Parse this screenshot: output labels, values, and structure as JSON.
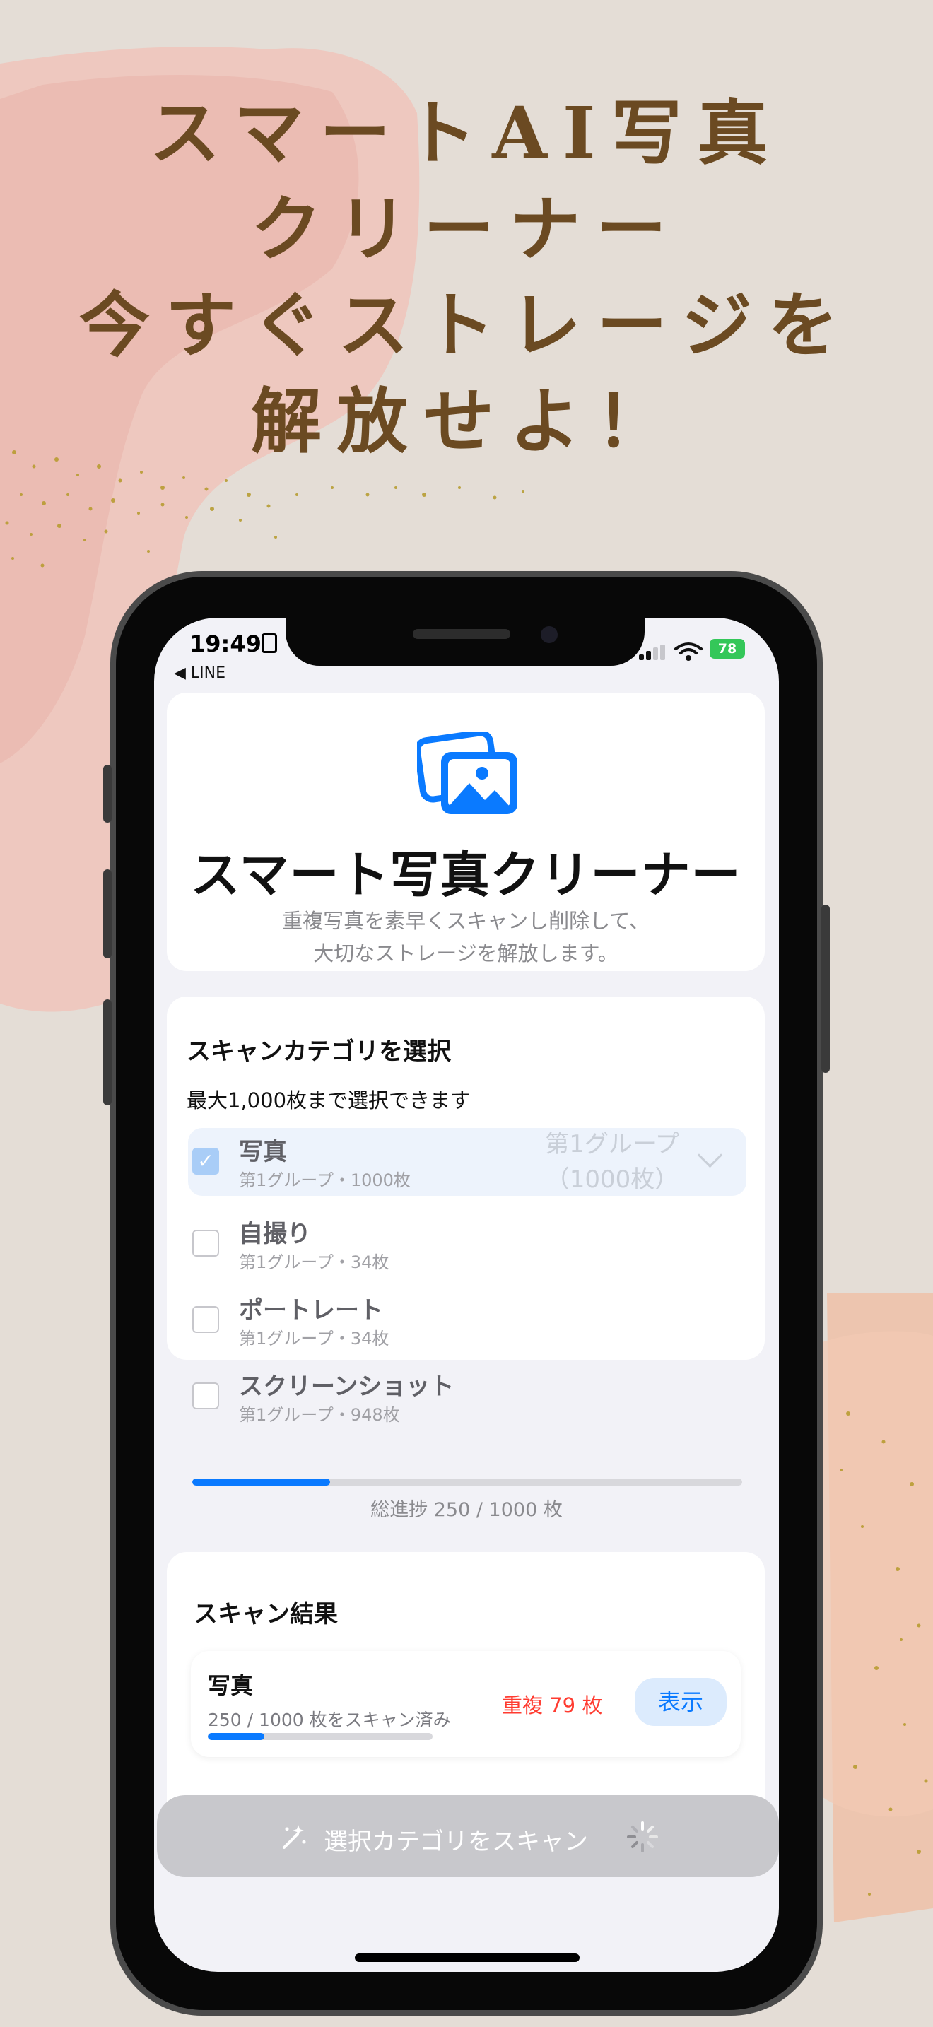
{
  "headline": {
    "line1": "スマートAI写真",
    "line2": "クリーナー",
    "line3": "今すぐストレージを",
    "line4": "解放せよ！"
  },
  "status_bar": {
    "time": "19:49",
    "back_label": "◀ LINE",
    "battery": "78"
  },
  "app_header": {
    "icon": "photo-stack-icon",
    "title": "スマート写真クリーナー",
    "subtitle_line1": "重複写真を素早くスキャンし削除して、",
    "subtitle_line2": "大切なストレージを解放します。"
  },
  "category_section": {
    "title": "スキャンカテゴリを選択",
    "limit_text": "最大1,000枚まで選択できます",
    "items": [
      {
        "name": "写真",
        "sub": "第1グループ・1000枚",
        "checked": true,
        "group_line1": "第1グループ",
        "group_line2": "（1000枚）"
      },
      {
        "name": "自撮り",
        "sub": "第1グループ・34枚",
        "checked": false
      },
      {
        "name": "ポートレート",
        "sub": "第1グループ・34枚",
        "checked": false
      },
      {
        "name": "スクリーンショット",
        "sub": "第1グループ・948枚",
        "checked": false
      }
    ]
  },
  "overall_progress": {
    "label": "総進捗 250 / 1000 枚",
    "done": 250,
    "total": 1000
  },
  "results_section": {
    "title": "スキャン結果",
    "items": [
      {
        "name": "写真",
        "progress_text": "250 / 1000 枚をスキャン済み",
        "duplicates": "重複 79 枚",
        "button": "表示",
        "done": 250,
        "total": 1000
      }
    ]
  },
  "scan_button": {
    "label": "選択カテゴリをスキャン",
    "icon": "magic-wand-icon",
    "spinner": "loading-spinner-icon"
  },
  "colors": {
    "background": "#e4ddd6",
    "headline": "#6b4a22",
    "accent": "#0a7aff",
    "duplicate": "#ff3b30"
  }
}
